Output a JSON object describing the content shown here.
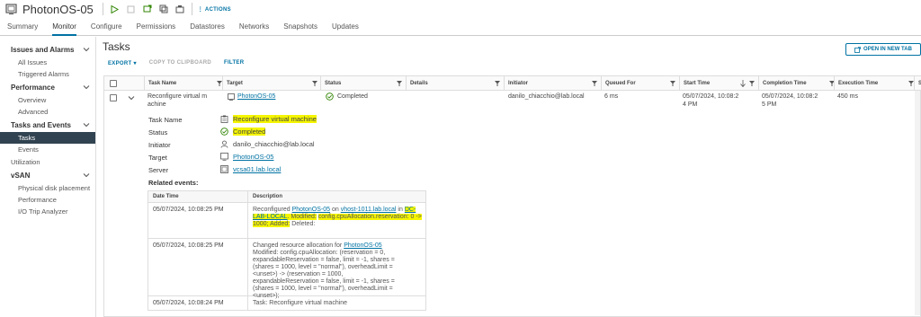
{
  "header": {
    "vm_name": "PhotonOS-05",
    "actions_label": "ACTIONS",
    "icons": [
      "vm-icon",
      "power-on-icon",
      "power-off-icon",
      "launch-console-icon",
      "migrate-icon",
      "snapshot-icon"
    ]
  },
  "tabs": [
    {
      "label": "Summary",
      "active": false
    },
    {
      "label": "Monitor",
      "active": true
    },
    {
      "label": "Configure",
      "active": false
    },
    {
      "label": "Permissions",
      "active": false
    },
    {
      "label": "Datastores",
      "active": false
    },
    {
      "label": "Networks",
      "active": false
    },
    {
      "label": "Snapshots",
      "active": false
    },
    {
      "label": "Updates",
      "active": false
    }
  ],
  "sidebar": {
    "issues": {
      "title": "Issues and Alarms",
      "items": [
        "All Issues",
        "Triggered Alarms"
      ]
    },
    "performance": {
      "title": "Performance",
      "items": [
        "Overview",
        "Advanced"
      ]
    },
    "tasks_events": {
      "title": "Tasks and Events",
      "items": [
        "Tasks",
        "Events"
      ]
    },
    "utilization": "Utilization",
    "vsan": {
      "title": "vSAN",
      "items": [
        "Physical disk placement",
        "Performance",
        "I/O Trip Analyzer"
      ]
    }
  },
  "main": {
    "title": "Tasks",
    "open_new_tab": "OPEN IN NEW TAB",
    "toolbar": {
      "export": "EXPORT",
      "copy": "COPY TO CLIPBOARD",
      "filter": "FILTER"
    }
  },
  "grid": {
    "columns": [
      "Task Name",
      "Target",
      "Status",
      "Details",
      "Initiator",
      "Queued For",
      "Start Time",
      "Completion Time",
      "Execution Time",
      "S"
    ],
    "row": {
      "task_name_1": "Reconfigure virtual m",
      "task_name_2": "achine",
      "target": "PhotonOS-05",
      "status": "Completed",
      "initiator": "danilo_chiacchio@lab.local",
      "queued_for": "6 ms",
      "start_time_1": "05/07/2024, 10:08:2",
      "start_time_2": "4 PM",
      "completion_time_1": "05/07/2024, 10:08:2",
      "completion_time_2": "5 PM",
      "execution_time": "450 ms"
    }
  },
  "details": {
    "task_name_label": "Task Name",
    "task_name_value": "Reconfigure virtual machine",
    "status_label": "Status",
    "status_value": "Completed",
    "initiator_label": "Initiator",
    "initiator_value": "danilo_chiacchio@lab.local",
    "target_label": "Target",
    "target_value": "PhotonOS-05",
    "server_label": "Server",
    "server_value": "vcsa01.lab.local",
    "related_label": "Related events:"
  },
  "events": {
    "columns": [
      "Date Time",
      "Description"
    ],
    "rows": [
      {
        "date": "05/07/2024, 10:08:25 PM",
        "pre": "Reconfigured",
        "vm": "PhotonOS-05",
        "on": "on",
        "host": "vhost-1011.lab.local",
        "in": "in",
        "dc": "DC-LAB-LOCAL",
        "modified": ". Modified:",
        "highlight": "config.cpuAllocation.reservation: 0 -> 1000; Added:",
        "deleted": "Deleted:"
      },
      {
        "date": "05/07/2024, 10:08:25 PM",
        "pre": "Changed resource allocation for",
        "vm": "PhotonOS-05",
        "lines": [
          "Modified: config.cpuAllocation: (reservation = 0,",
          "expandableReservation = false, limit = -1, shares =",
          "(shares = 1000, level = \"normal\"), overheadLimit =",
          "<unset>) -> (reservation = 1000,",
          "expandableReservation = false, limit = -1, shares =",
          "(shares = 1000, level = \"normal\"), overheadLimit =",
          "<unset>);"
        ]
      },
      {
        "date": "05/07/2024, 10:08:24 PM",
        "desc": "Task: Reconfigure virtual machine"
      }
    ]
  },
  "colors": {
    "accent": "#0072a3",
    "active_nav": "#314351",
    "highlight": "#f5f500",
    "success": "#2f8400"
  }
}
